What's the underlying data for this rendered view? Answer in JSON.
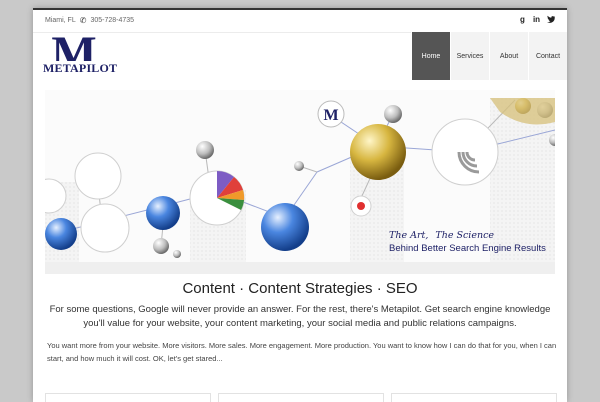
{
  "topbar": {
    "location": "Miami, FL",
    "phone": "305-728-4735",
    "social": [
      "g",
      "in",
      "t"
    ]
  },
  "logo": {
    "letter": "M",
    "name": "METAPILOT"
  },
  "nav": {
    "items": [
      "Home",
      "Services",
      "About",
      "Contact"
    ],
    "active": "Home"
  },
  "banner": {
    "tagline_italic_1": "The Art,",
    "tagline_italic_2": "The Science",
    "tagline_main": "Behind Better Search Engine Results",
    "badge_letter": "M"
  },
  "main": {
    "heading": "Content · Content Strategies · SEO",
    "lead": "For some questions, Google will never provide an answer. For the rest, there's Metapilot. Get search engine knowledge you'll value for your website, your content marketing, your social media and public relations campaigns.",
    "body": "You want more from your website. More visitors. More sales. More engagement. More production. You want to know how I can do that for you, when I can start, and how much it will cost. OK, let's get stared..."
  },
  "colors": {
    "brand": "#1e2166",
    "nav_active": "#555555",
    "accent_blue": "#3a6fcf",
    "accent_gold": "#c9a42a"
  }
}
